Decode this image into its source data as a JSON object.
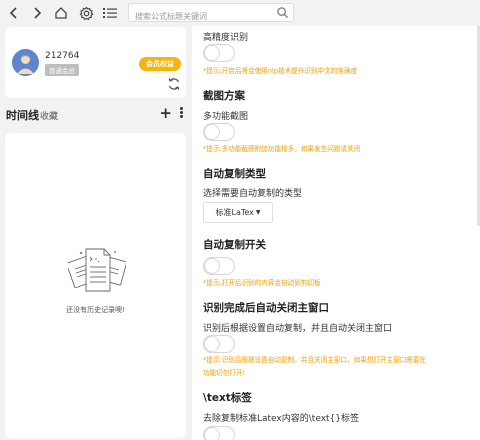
{
  "toolbar": {
    "search_placeholder": "搜索公式标题关键词",
    "icons": [
      "back-icon",
      "forward-icon",
      "home-icon",
      "settings-icon",
      "list-icon",
      "search-icon"
    ]
  },
  "user": {
    "id": "212764",
    "member_level": "普通会员",
    "vip_button": "会员权益"
  },
  "timeline": {
    "title": "时间线",
    "favorites": "收藏",
    "empty_text": "还没有历史记录噢!"
  },
  "settings": {
    "high_precision": {
      "label": "高精度识别",
      "tip": "*提示:开启后将会使用nlp技术提升识别中文的准确度"
    },
    "screenshot": {
      "heading": "截图方案",
      "label": "多功能截图",
      "tip": "*提示:多功能截图附加功能较多，如果发生问题请关闭"
    },
    "auto_copy_type": {
      "heading": "自动复制类型",
      "label": "选择需要自动复制的类型",
      "selected": "标准LaTex"
    },
    "auto_copy_switch": {
      "heading": "自动复制开关",
      "tip": "*提示:打开后识别的内容会自动到剪切板"
    },
    "auto_close": {
      "heading": "识别完成后自动关闭主窗口",
      "label": "识别后根据设置自动复制，并且自动关闭主窗口",
      "tip_line1": "*提示:识别后根据设置自动复制，并且关闭主窗口，如果想打开主窗口需要在",
      "tip_line2": "功能切勿打开!"
    },
    "text_tag": {
      "heading": "\\text标签",
      "label": "去除复制标准Latex内容的\\text{}标签"
    }
  },
  "colors": {
    "accent": "#f5b50c",
    "tip": "#f0a000",
    "background": "#f2f2f2"
  }
}
